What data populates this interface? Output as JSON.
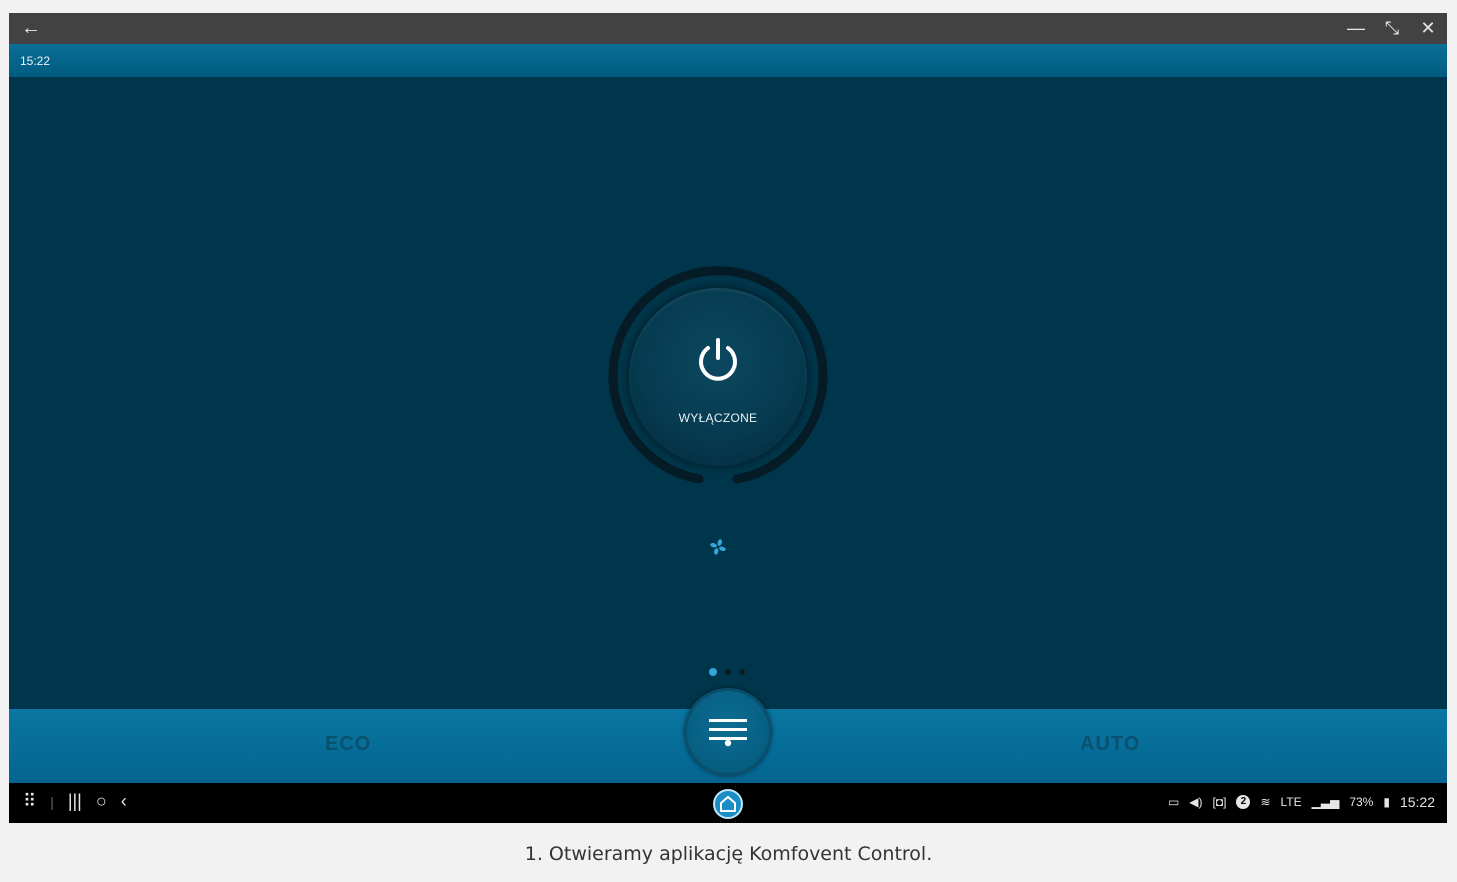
{
  "titlebar": {
    "back_icon": "←",
    "minimize_icon": "—",
    "restore_icon": "⤡",
    "close_icon": "✕"
  },
  "statusbar": {
    "time": "15:22"
  },
  "dial": {
    "state_label": "WYŁĄCZONE",
    "fan_level_fraction": 0.0
  },
  "pager": {
    "pages": 3,
    "active": 0
  },
  "bottombar": {
    "left_mode": "ECO",
    "right_mode": "AUTO"
  },
  "navbar": {
    "apps_icon": "⠿",
    "recents_icon": "|||",
    "home_icon": "○",
    "back_icon": "‹",
    "notification_count": "2",
    "network": "LTE",
    "battery": "73%",
    "clock": "15:22"
  },
  "caption": "1. Otwieramy aplikację Komfovent Control.",
  "colors": {
    "background": "#00364b",
    "accent": "#35a6dc",
    "bar": "#0a76a2"
  }
}
